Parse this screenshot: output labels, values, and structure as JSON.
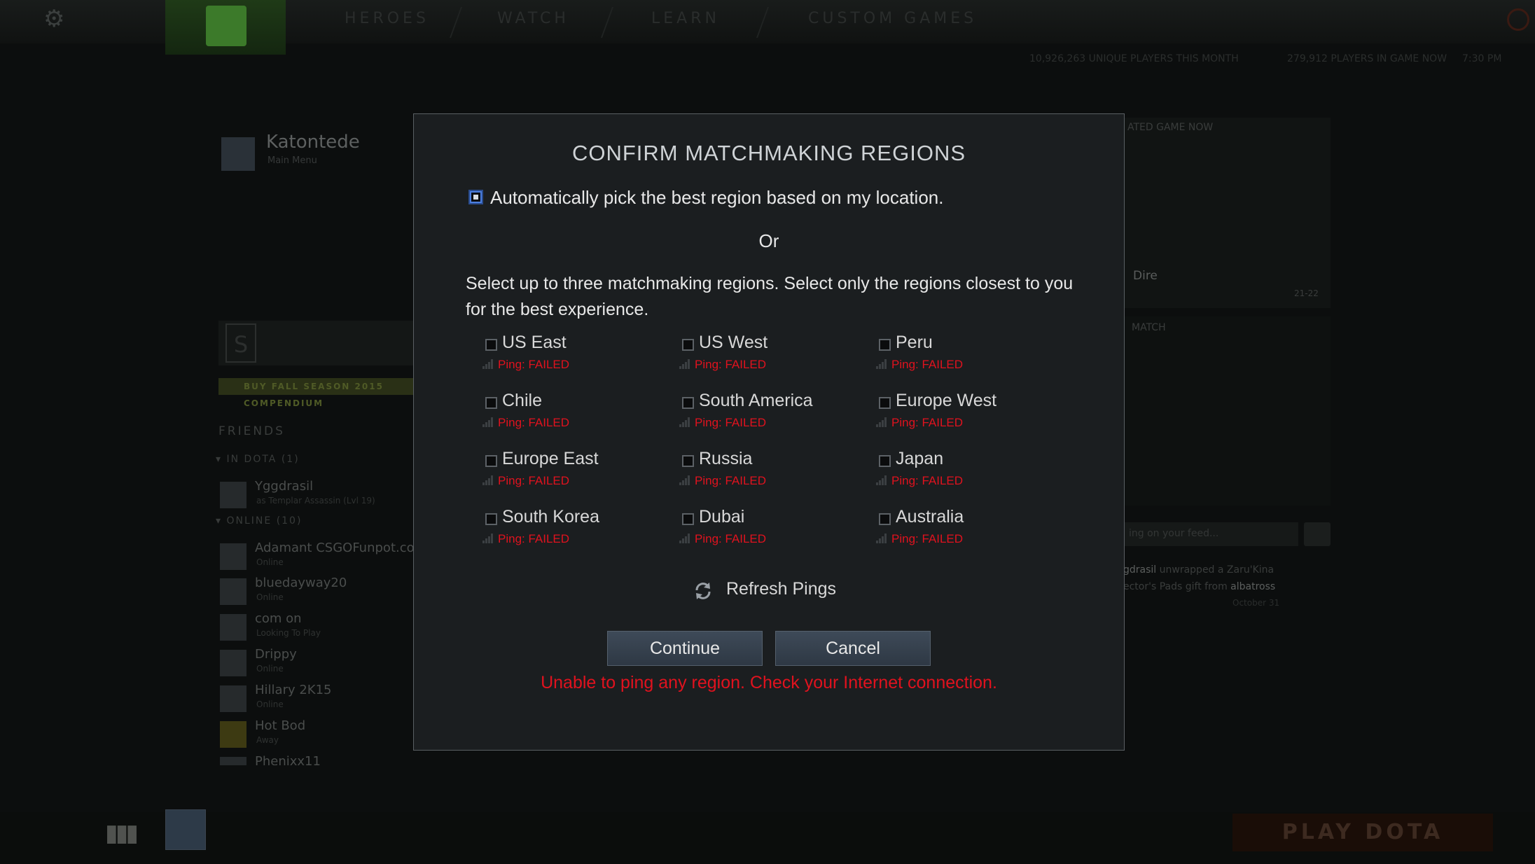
{
  "topnav": {
    "items": [
      "HEROES",
      "WATCH",
      "LEARN",
      "CUSTOM GAMES"
    ],
    "stats": [
      "10,926,263 UNIQUE PLAYERS THIS MONTH",
      "279,912 PLAYERS IN GAME NOW",
      "7:30 PM"
    ]
  },
  "profile": {
    "name": "Katontede",
    "status": "Main Menu"
  },
  "season": {
    "buy_label": "BUY FALL SEASON 2015 COMPENDIUM"
  },
  "friends": {
    "title": "FRIENDS",
    "in_dota_label": "IN DOTA",
    "in_dota_count": "(1)",
    "online_label": "ONLINE",
    "online_count": "(10)",
    "list": [
      {
        "name": "Yggdrasil",
        "status": "as Templar Assassin (Lvl 19)"
      },
      {
        "name": "Adamant CSGOFunpot.com",
        "status": "Online"
      },
      {
        "name": "bluedayway20",
        "status": "Online"
      },
      {
        "name": "com on",
        "status": "Looking To Play"
      },
      {
        "name": "Drippy",
        "status": "Online"
      },
      {
        "name": "Hillary 2K15",
        "status": "Online"
      },
      {
        "name": "Hot Bod",
        "status": "Away"
      },
      {
        "name": "Phenixx11",
        "status": ""
      }
    ]
  },
  "right_panel": {
    "header": "ATED GAME NOW",
    "team": "Dire",
    "score": "21-22",
    "match_label": "MATCH",
    "feed_placeholder": "ing on your feed...",
    "feed_line1_name": "gdrasil",
    "feed_line1_rest": " unwrapped a Zaru'Kina",
    "feed_line2_rest": "ector's Pads gift from ",
    "feed_line2_name": "albatross",
    "feed_date": "October 31"
  },
  "bottom": {
    "play_label": "PLAY DOTA"
  },
  "modal": {
    "title": "CONFIRM MATCHMAKING REGIONS",
    "auto_label": "Automatically pick the best region based on my location.",
    "or_label": "Or",
    "instructions": "Select up to three matchmaking regions. Select only the regions closest to you for the best experience.",
    "regions": [
      {
        "name": "US East",
        "ping": "Ping: FAILED"
      },
      {
        "name": "US West",
        "ping": "Ping: FAILED"
      },
      {
        "name": "Peru",
        "ping": "Ping: FAILED"
      },
      {
        "name": "Chile",
        "ping": "Ping: FAILED"
      },
      {
        "name": "South America",
        "ping": "Ping: FAILED"
      },
      {
        "name": "Europe West",
        "ping": "Ping: FAILED"
      },
      {
        "name": "Europe East",
        "ping": "Ping: FAILED"
      },
      {
        "name": "Russia",
        "ping": "Ping: FAILED"
      },
      {
        "name": "Japan",
        "ping": "Ping: FAILED"
      },
      {
        "name": "South Korea",
        "ping": "Ping: FAILED"
      },
      {
        "name": "Dubai",
        "ping": "Ping: FAILED"
      },
      {
        "name": "Australia",
        "ping": "Ping: FAILED"
      }
    ],
    "refresh_label": "Refresh Pings",
    "continue_label": "Continue",
    "cancel_label": "Cancel",
    "error_message": "Unable to ping any region.  Check your Internet connection."
  },
  "colors": {
    "error": "#e0121e",
    "accent": "#4c7fe0",
    "modal_bg": "#1b1e20"
  }
}
